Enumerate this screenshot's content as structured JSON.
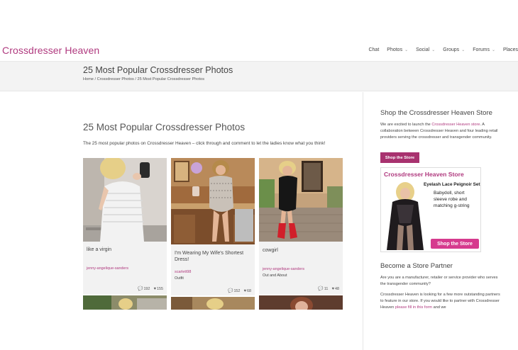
{
  "site": {
    "logo": "Crossdresser Heaven"
  },
  "nav": [
    {
      "label": "Chat",
      "has_menu": false
    },
    {
      "label": "Photos",
      "has_menu": true
    },
    {
      "label": "Social",
      "has_menu": true
    },
    {
      "label": "Groups",
      "has_menu": true
    },
    {
      "label": "Forums",
      "has_menu": true
    },
    {
      "label": "Places",
      "has_menu": false
    }
  ],
  "titlebar": {
    "title": "25 Most Popular Crossdresser Photos",
    "breadcrumb": "Home / Crossdresser Photos / 25 Most Popular Crossdresser Photos"
  },
  "main": {
    "heading": "25 Most Popular Crossdresser Photos",
    "intro": "The 25 most popular photos on Crossdresser Heaven – click through and comment to let the ladies know what you think!"
  },
  "cards": [
    {
      "caption": "like a virgin",
      "author": "jenny-angelique-sanders",
      "category": "",
      "comments": "192",
      "likes": "155"
    },
    {
      "caption": "I'm Wearing My Wife's Shortest Dress!",
      "author": "scarlett98",
      "category": "Outfit",
      "comments": "152",
      "likes": "68"
    },
    {
      "caption": "cowgirl",
      "author": "jenny-angelique-sanders",
      "category": "Out and About",
      "comments": "11",
      "likes": "48"
    }
  ],
  "sidebar": {
    "store_heading": "Shop the Crossdresser Heaven Store",
    "store_text_1": "We are excited to launch the ",
    "store_link": "Crossdresser Heaven store",
    "store_text_2": ". A collaboration between Crossdresser Heaven and four leading retail providers serving the crossdresser and transgender community.",
    "shop_button": "Shop the Store",
    "ad": {
      "title": "Crossdresser Heaven Store",
      "product": "Eyelash Lace Peignoir Set",
      "desc": "Babydoll, short sleeve robe and matching g-string",
      "button": "Shop the Store"
    },
    "partner_heading": "Become a Store Partner",
    "partner_text_1": "Are you are a manufacturer, retailer or service provider who serves the transgender community?",
    "partner_text_2": "Crossdresser Heaven is looking for a few more outstanding partners to feature in our store. If you would like to partner with Crossdresser Heaven ",
    "partner_link": "please fill in this form",
    "partner_text_3": " and we"
  },
  "colors": {
    "brand": "#b03a7f",
    "button": "#a8326f",
    "ad_button": "#d63a8e"
  }
}
